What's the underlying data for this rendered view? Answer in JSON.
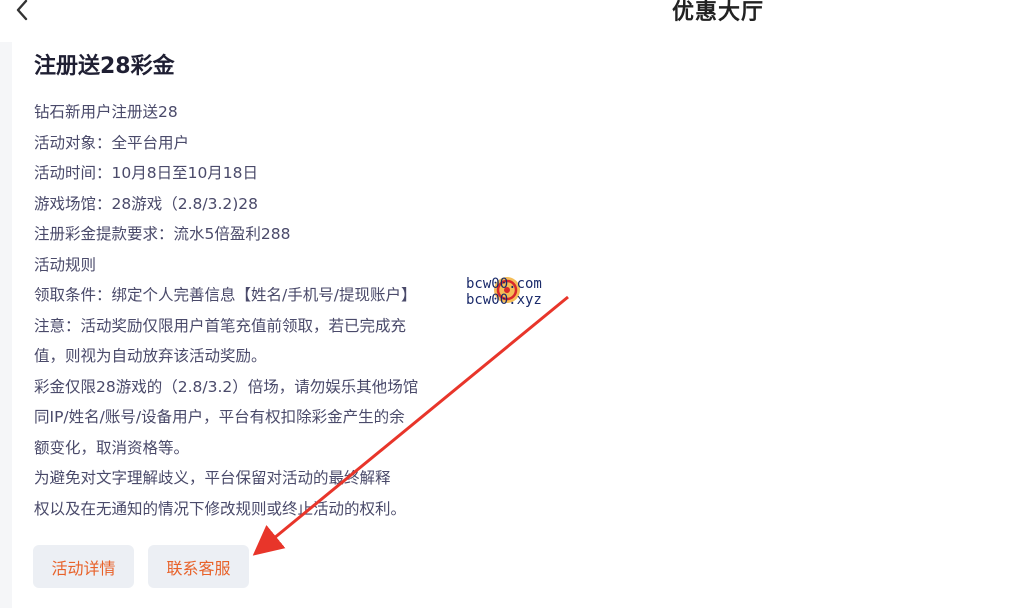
{
  "header": {
    "title": "优惠大厅"
  },
  "promo": {
    "title": "注册送28彩金",
    "lines": [
      "钻石新用户注册送28",
      "活动对象：全平台用户",
      "活动时间：10月8日至10月18日",
      "游戏场馆：28游戏（2.8/3.2)28",
      "注册彩金提款要求：流水5倍盈利288",
      "活动规则",
      "领取条件：绑定个人完善信息【姓名/手机号/提现账户】",
      "注意：活动奖励仅限用户首笔充值前领取，若已完成充",
      "值，则视为自动放弃该活动奖励。",
      "彩金仅限28游戏的（2.8/3.2）倍场，请勿娱乐其他场馆",
      "同IP/姓名/账号/设备用户，平台有权扣除彩金产生的余",
      "额变化，取消资格等。",
      "为避免对文字理解歧义，平台保留对活动的最终解释",
      "权以及在无通知的情况下修改规则或终止活动的权利。"
    ]
  },
  "buttons": {
    "details": "活动详情",
    "support": "联系客服"
  },
  "watermark": {
    "line1": "bcw00.com",
    "line2": "bcw00.xyz"
  },
  "colors": {
    "accent": "#e8622a",
    "arrow": "#e8352a",
    "text": "#4a4a6a",
    "title": "#1f1f33"
  }
}
